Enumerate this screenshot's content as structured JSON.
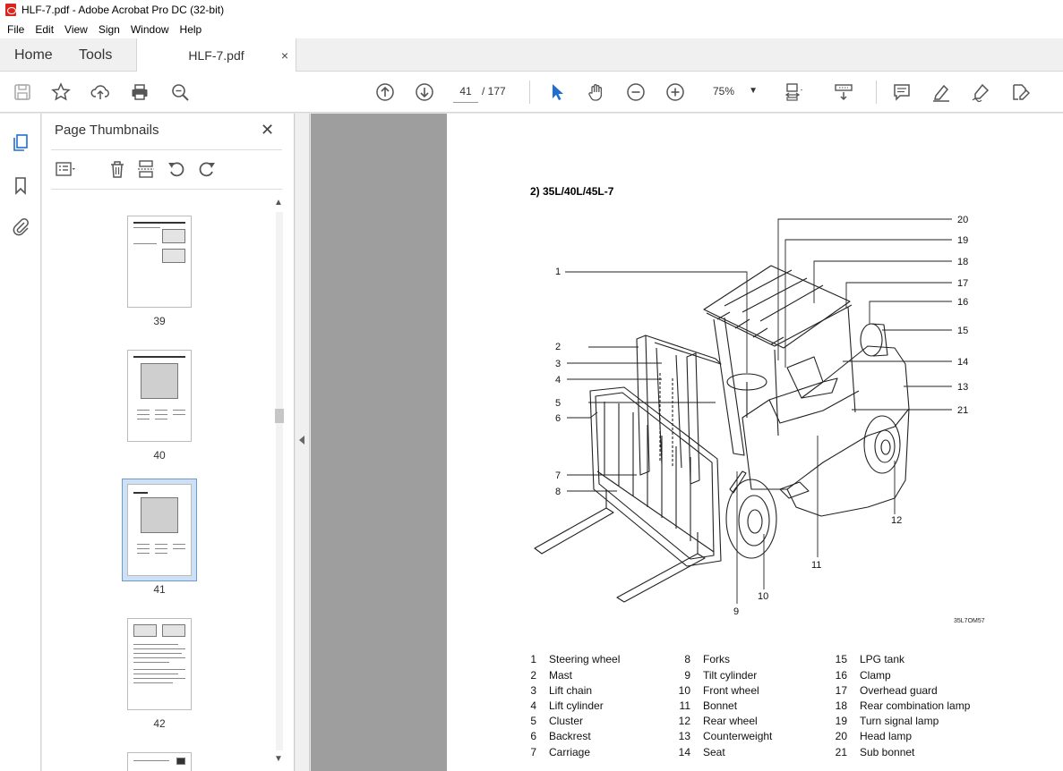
{
  "window": {
    "title": "HLF-7.pdf - Adobe Acrobat Pro DC (32-bit)"
  },
  "menu": [
    "File",
    "Edit",
    "View",
    "Sign",
    "Window",
    "Help"
  ],
  "tabs": {
    "home": "Home",
    "tools": "Tools",
    "document": "HLF-7.pdf",
    "close": "×"
  },
  "toolbar": {
    "current_page": "41",
    "page_total": "/ 177",
    "zoom": "75%"
  },
  "thumbnails": {
    "title": "Page Thumbnails",
    "close": "✕",
    "pages": [
      {
        "number": "39",
        "selected": false
      },
      {
        "number": "40",
        "selected": false
      },
      {
        "number": "41",
        "selected": true
      },
      {
        "number": "42",
        "selected": false
      }
    ]
  },
  "document": {
    "heading": "2) 35L/40L/45L-7",
    "figure_ref": "35L7OM57",
    "callouts": [
      "1",
      "2",
      "3",
      "4",
      "5",
      "6",
      "7",
      "8",
      "9",
      "10",
      "11",
      "12",
      "13",
      "14",
      "15",
      "16",
      "17",
      "18",
      "19",
      "20",
      "21"
    ],
    "legend": [
      {
        "n": "1",
        "label": "Steering wheel"
      },
      {
        "n": "2",
        "label": "Mast"
      },
      {
        "n": "3",
        "label": "Lift chain"
      },
      {
        "n": "4",
        "label": "Lift cylinder"
      },
      {
        "n": "5",
        "label": "Cluster"
      },
      {
        "n": "6",
        "label": "Backrest"
      },
      {
        "n": "7",
        "label": "Carriage"
      },
      {
        "n": "8",
        "label": "Forks"
      },
      {
        "n": "9",
        "label": "Tilt cylinder"
      },
      {
        "n": "10",
        "label": "Front wheel"
      },
      {
        "n": "11",
        "label": "Bonnet"
      },
      {
        "n": "12",
        "label": "Rear wheel"
      },
      {
        "n": "13",
        "label": "Counterweight"
      },
      {
        "n": "14",
        "label": "Seat"
      },
      {
        "n": "15",
        "label": "LPG tank"
      },
      {
        "n": "16",
        "label": "Clamp"
      },
      {
        "n": "17",
        "label": "Overhead guard"
      },
      {
        "n": "18",
        "label": "Rear combination lamp"
      },
      {
        "n": "19",
        "label": "Turn signal lamp"
      },
      {
        "n": "20",
        "label": "Head lamp"
      },
      {
        "n": "21",
        "label": "Sub bonnet"
      }
    ]
  }
}
